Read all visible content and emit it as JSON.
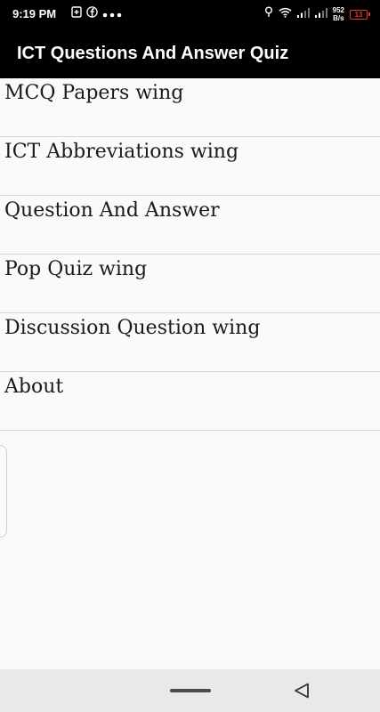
{
  "status_bar": {
    "time": "9:19 PM",
    "network_speed_value": "952",
    "network_speed_unit": "B/s",
    "battery_level": "13"
  },
  "app_bar": {
    "title": "ICT Questions And Answer Quiz"
  },
  "menu": {
    "items": [
      {
        "label": "MCQ Papers wing"
      },
      {
        "label": "ICT Abbreviations wing"
      },
      {
        "label": "Question And Answer"
      },
      {
        "label": "Pop Quiz wing"
      },
      {
        "label": "Discussion Question wing"
      },
      {
        "label": "About"
      }
    ]
  },
  "colors": {
    "app_bar_bg": "#000000",
    "background": "#fafafa",
    "battery_low": "#e53935"
  }
}
